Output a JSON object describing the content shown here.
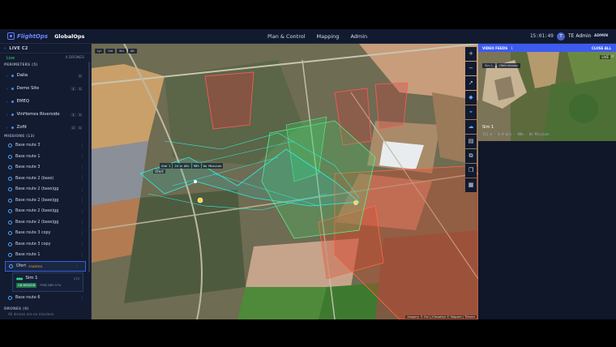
{
  "header": {
    "brand": "FlightOps",
    "org": "GlobalOps",
    "nav": [
      "Plan & Control",
      "Mapping",
      "Admin"
    ],
    "clock": "15:01:49",
    "avatar_initial": "T",
    "user_name": "TE Admin",
    "user_role": "ADMIN"
  },
  "sidebar": {
    "title": "LIVE C2",
    "live_label": "Live",
    "drones_count": "4 DRONES",
    "perimeters_label": "PERIMETERS (5)",
    "perimeters": [
      {
        "name": "Dalia",
        "b1": "1",
        "b2": ""
      },
      {
        "name": "Demo Site",
        "b1": "1",
        "b2": "1"
      },
      {
        "name": "EMEQ",
        "b1": "",
        "b2": ""
      },
      {
        "name": "VinHomes Riverside",
        "b1": "1",
        "b2": "1"
      },
      {
        "name": "Zofit",
        "b1": "1",
        "b2": "1"
      }
    ],
    "missions_label": "MISSIONS (13)",
    "missions": [
      "Base route 3",
      "Base route 1",
      "Base route 3",
      "Base route 2 (base)",
      "Base route 2 (base)gg",
      "Base route 2 (base)gg",
      "Base route 2 (base)gg",
      "Base route 2 (base)gg",
      "Base route 3 copy",
      "Base route 3 copy",
      "Base route 1"
    ],
    "active_mission": {
      "name": "Ofert",
      "status": "STARTED"
    },
    "drone_card": {
      "name": "Sim 1",
      "tag": "172",
      "state": "ON MISSION",
      "telemetry": "FREE BRS 57%"
    },
    "last_mission": "Base route 6",
    "drones_label": "DRONES (0)",
    "drones_empty": "All drones are on missions"
  },
  "map": {
    "layer_chips": [
      "Lyr",
      "Vid",
      "Stn",
      "Alt"
    ],
    "tools": [
      "+",
      "−",
      "➚",
      "◆",
      "⌖",
      "☁",
      "▤",
      "⧉",
      "❒",
      "▦"
    ],
    "hud": [
      "Sim 1",
      "24 m AGL",
      "98%",
      "On Mission"
    ],
    "hud_mission": "Ofert",
    "attribution": "Imagery © Esri | Elevation © Mapzen / Tilezen"
  },
  "video": {
    "title": "VIDEO FEEDS",
    "count": "1",
    "close_all": "CLOSE ALL",
    "tabs": [
      "Sim 1",
      "Ofert mission"
    ],
    "live": "LIVE",
    "feed_name": "Sim 1",
    "feed_telemetry": "111 m · 4.9 m/s · 98% · On Mission"
  }
}
